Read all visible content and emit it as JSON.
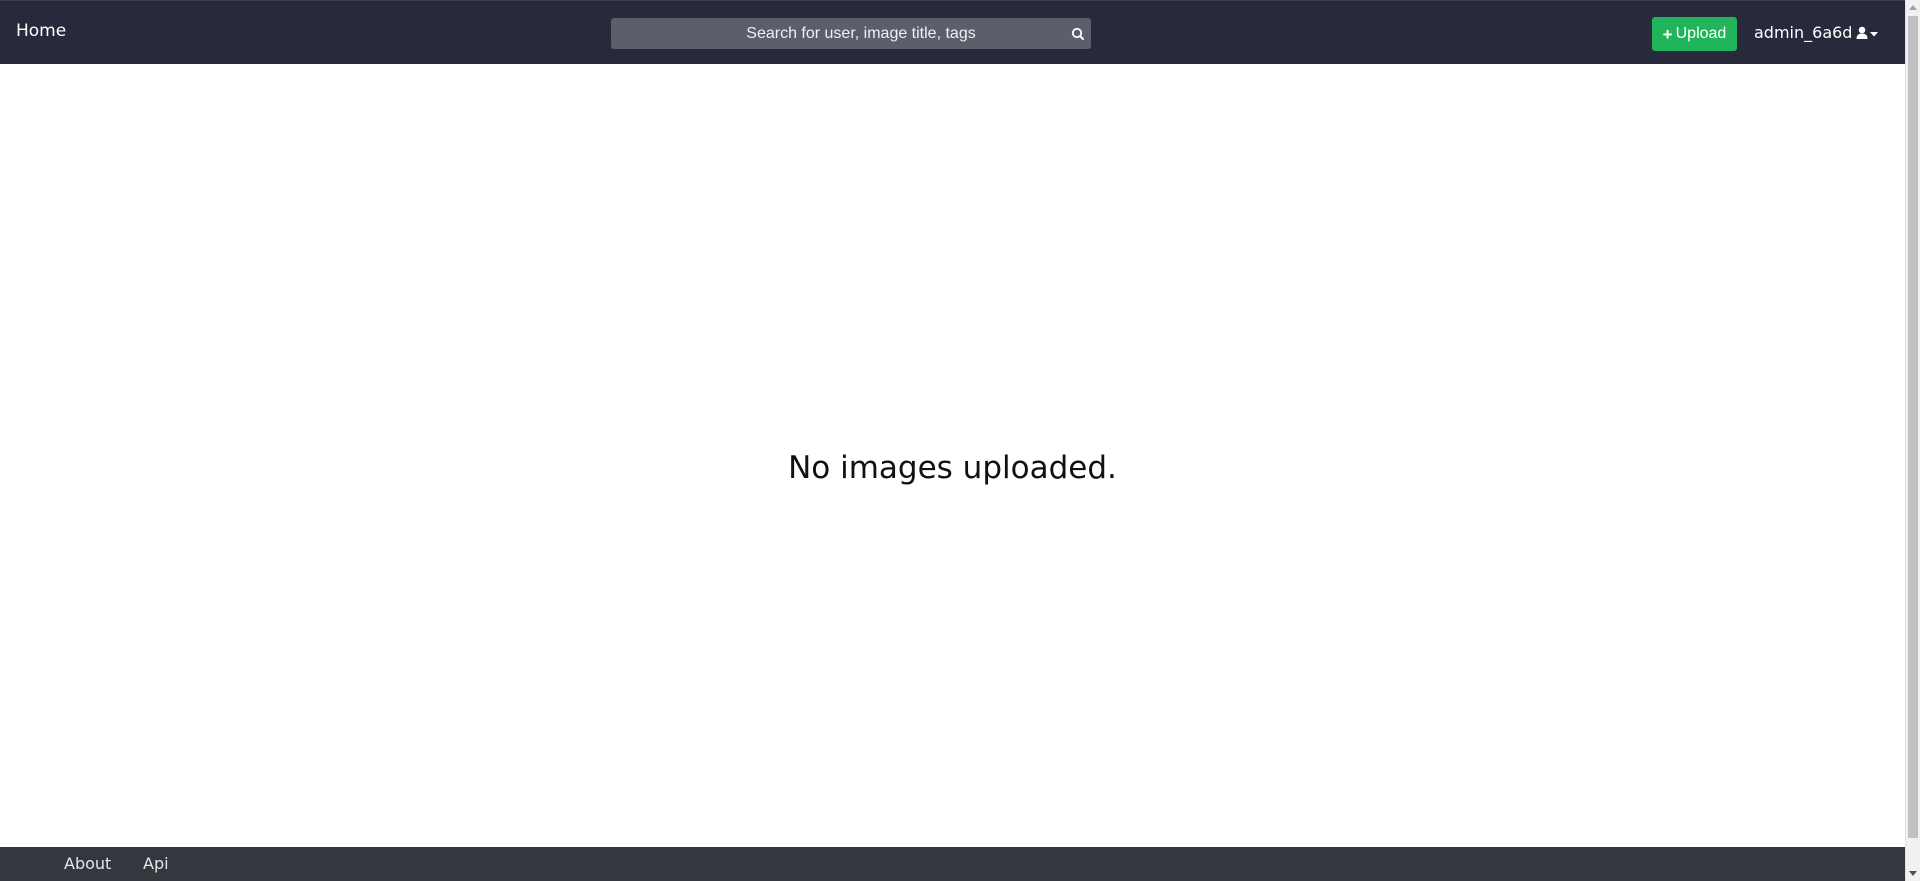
{
  "navbar": {
    "home_label": "Home",
    "search": {
      "placeholder": "Search for user, image title, tags",
      "value": "",
      "icon": "search-icon"
    },
    "upload_label": "Upload",
    "upload_icon": "plus-icon",
    "username": "admin_6a6d",
    "user_menu_icon": "user-icon"
  },
  "main": {
    "empty_message": "No images uploaded."
  },
  "footer": {
    "links": [
      {
        "label": "About"
      },
      {
        "label": "Api"
      }
    ]
  },
  "colors": {
    "navbar_bg": "#262a3a",
    "search_bg": "#5b5f6c",
    "upload_bg": "#21b45a",
    "footer_bg": "#33373e"
  }
}
